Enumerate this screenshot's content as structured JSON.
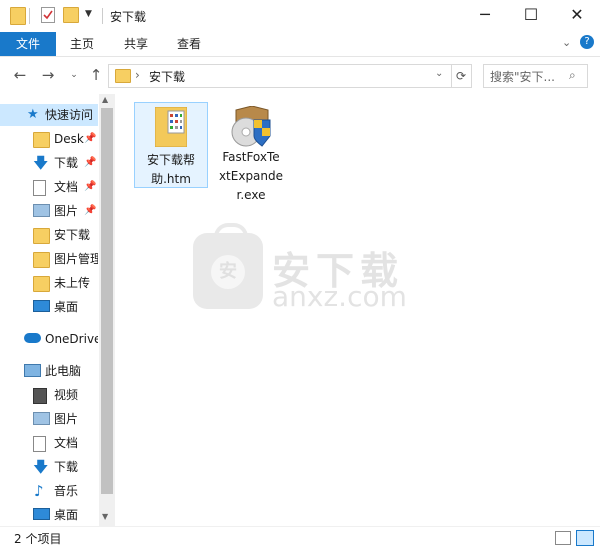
{
  "window": {
    "title": "安下载"
  },
  "ribbon": {
    "tabs": [
      "文件",
      "主页",
      "共享",
      "查看"
    ]
  },
  "address": {
    "crumb": "安下载",
    "separator": "›"
  },
  "search": {
    "placeholder": "搜索\"安下..."
  },
  "nav": {
    "quick_access": "快速访问",
    "quick_items": [
      "Desk",
      "下载",
      "文档",
      "图片",
      "安下载",
      "图片管理",
      "未上传",
      "桌面"
    ],
    "onedrive": "OneDrive",
    "this_pc": "此电脑",
    "pc_items": [
      "视频",
      "图片",
      "文档",
      "下载",
      "音乐",
      "桌面"
    ]
  },
  "files": [
    {
      "name": "安下载帮助.htm",
      "line1": "安下载帮",
      "line2": "助.htm"
    },
    {
      "name": "FastFoxTextExpander.exe",
      "line1": "FastFoxTe",
      "line2": "xtExpande",
      "line3": "r.exe"
    }
  ],
  "watermark": {
    "text": "安下载",
    "url": "anxz.com",
    "bag_char": "安"
  },
  "status": {
    "count": "2 个项目"
  },
  "colors": {
    "accent": "#1979ca",
    "selection": "#cce8ff",
    "folder": "#f7cf62"
  }
}
